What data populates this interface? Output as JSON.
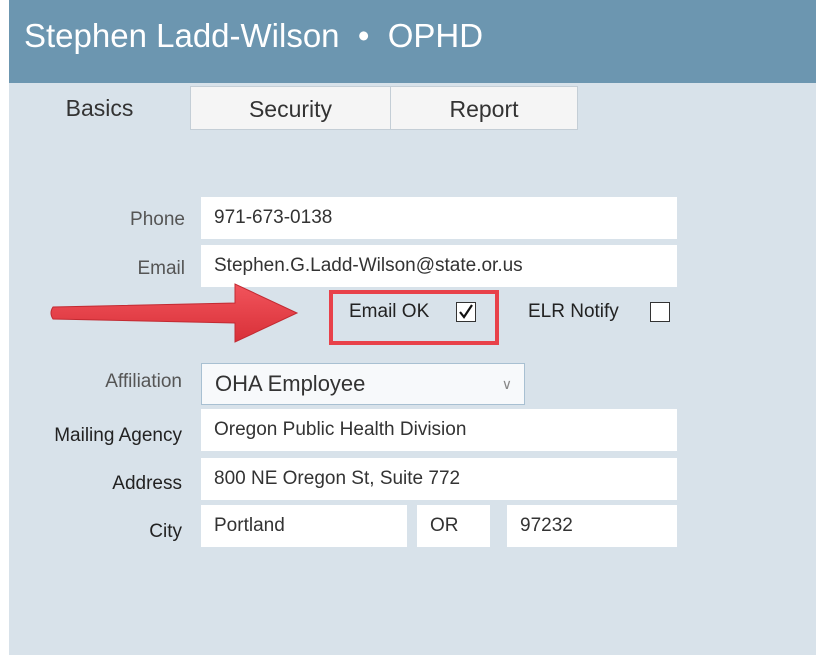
{
  "window": {
    "title": "Stephen Ladd-Wilson  •  OPHD"
  },
  "tabs": [
    {
      "label": "Basics",
      "active": true
    },
    {
      "label": "Security",
      "active": false
    },
    {
      "label": "Report",
      "active": false
    }
  ],
  "form": {
    "phone": {
      "label": "Phone",
      "value": "971-673-0138"
    },
    "email": {
      "label": "Email",
      "value": "Stephen.G.Ladd-Wilson@state.or.us"
    },
    "email_ok": {
      "label": "Email OK",
      "checked": true
    },
    "elr_notify": {
      "label": "ELR Notify",
      "checked": false
    },
    "affiliation": {
      "label": "Affiliation",
      "selected": "OHA Employee"
    },
    "mailing_agency": {
      "label": "Mailing Agency",
      "value": "Oregon Public Health Division"
    },
    "address": {
      "label": "Address",
      "value": "800 NE Oregon St, Suite 772"
    },
    "city": {
      "label": "City",
      "value": "Portland"
    },
    "state": {
      "value": "OR"
    },
    "zip": {
      "value": "97232"
    }
  },
  "icons": {
    "checkmark": "check-icon",
    "dropdown": "chevron-down-icon",
    "annotation": "red-arrow"
  },
  "colors": {
    "titlebar": "#6c96b0",
    "background": "#d8e2ea",
    "highlight": "#e8414a"
  }
}
